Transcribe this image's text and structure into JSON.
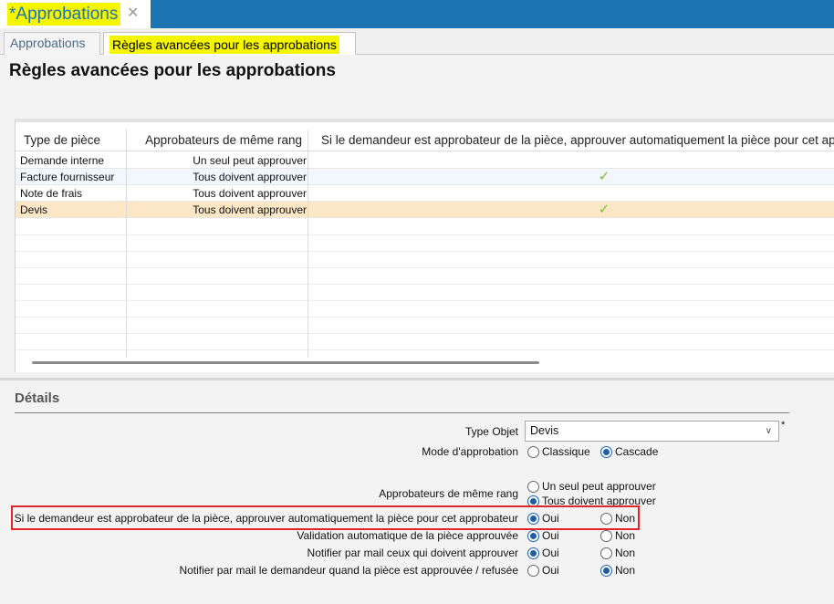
{
  "document_tab": {
    "title": "*Approbations",
    "close": "✕"
  },
  "subtabs": [
    {
      "label": "Approbations"
    },
    {
      "label": "Règles avancées pour les approbations"
    }
  ],
  "page_title": "Règles avancées pour les approbations",
  "grid": {
    "columns": [
      "Type de pièce",
      "Approbateurs de même rang",
      "Si le demandeur est approbateur de la pièce, approuver automatiquement la pièce pour cet approbateur"
    ],
    "rows": [
      {
        "type": "Demande interne",
        "rank": "Un seul peut approuver",
        "auto": ""
      },
      {
        "type": "Facture fournisseur",
        "rank": "Tous doivent approuver",
        "auto": "✓"
      },
      {
        "type": "Note de frais",
        "rank": "Tous doivent approuver",
        "auto": ""
      },
      {
        "type": "Devis",
        "rank": "Tous doivent approuver",
        "auto": "✓"
      }
    ]
  },
  "details": {
    "title": "Détails",
    "type_objet": {
      "label": "Type Objet",
      "value": "Devis",
      "required_mark": "*",
      "chevron": "∨"
    },
    "mode": {
      "label": "Mode d'approbation",
      "options": [
        "Classique",
        "Cascade"
      ],
      "selected": "Cascade"
    },
    "rank": {
      "label": "Approbateurs de même rang",
      "options": [
        "Un seul peut approuver",
        "Tous doivent approuver"
      ],
      "selected": "Tous doivent approuver"
    },
    "auto_approve": {
      "label": "Si le demandeur est approbateur de la pièce, approuver automatiquement la pièce pour cet approbateur",
      "yes": "Oui",
      "no": "Non",
      "selected": "Oui"
    },
    "auto_validation": {
      "label": "Validation automatique de la pièce approuvée",
      "yes": "Oui",
      "no": "Non",
      "selected": "Oui"
    },
    "notify_approvers": {
      "label": "Notifier par mail ceux qui doivent approuver",
      "yes": "Oui",
      "no": "Non",
      "selected": "Oui"
    },
    "notify_requester": {
      "label": "Notifier par mail le demandeur quand la pièce est approuvée / refusée",
      "yes": "Oui",
      "no": "Non",
      "selected": "Non"
    }
  },
  "colors": {
    "accent": "#1d74b3",
    "highlight": "#f5f500",
    "selected_row": "#fbe7c6",
    "check": "#7cbb3a",
    "annotation_box": "#e0242a"
  }
}
